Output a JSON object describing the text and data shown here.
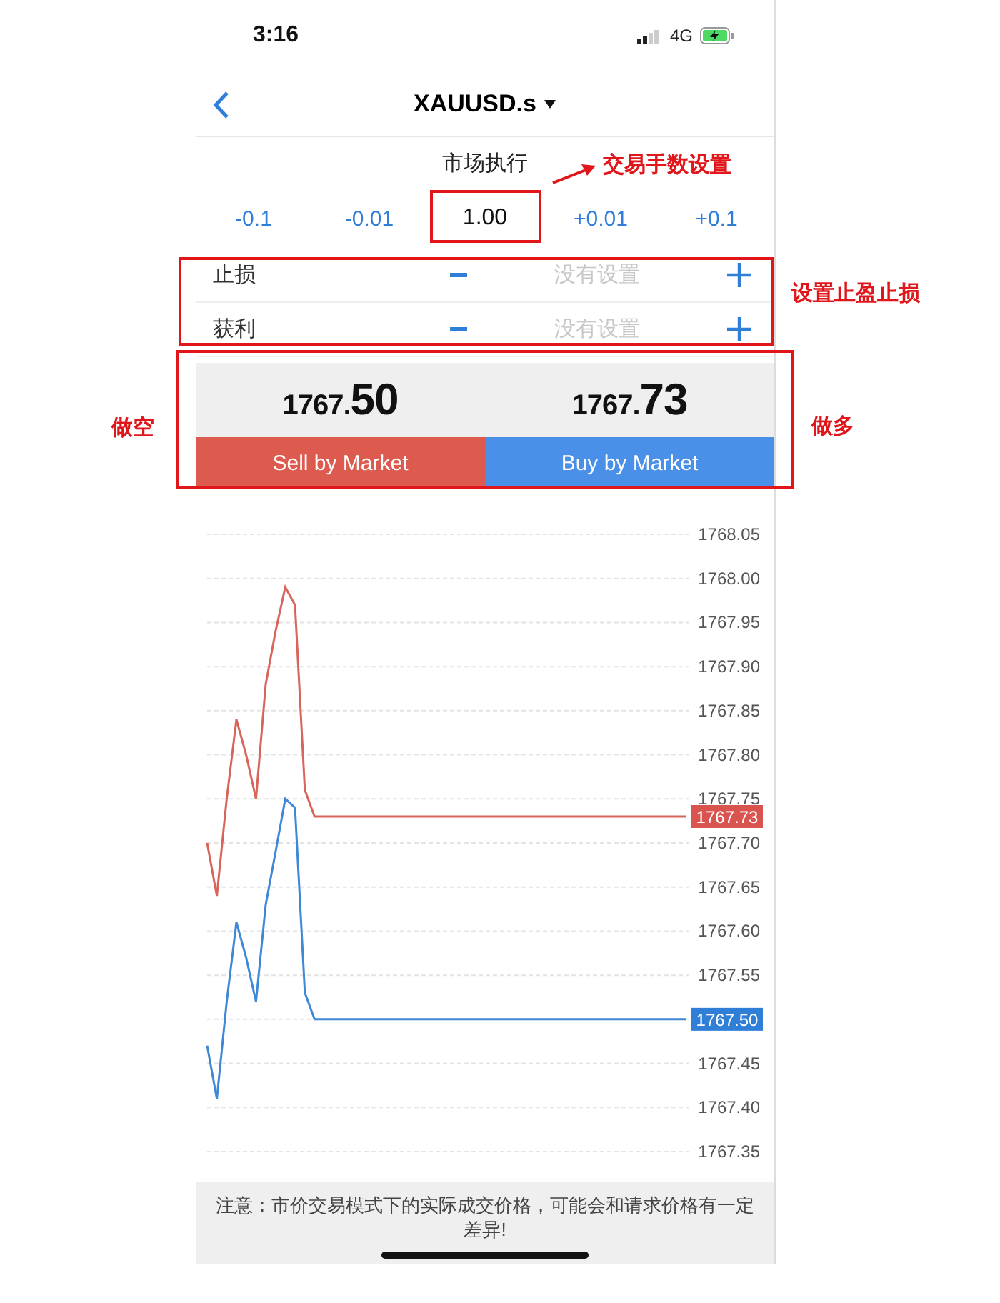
{
  "status_bar": {
    "time": "3:16",
    "network": "4G"
  },
  "nav": {
    "title": "XAUUSD.s"
  },
  "order": {
    "mode": "市场执行",
    "lot_steps_minus": [
      "-0.1",
      "-0.01"
    ],
    "volume": "1.00",
    "lot_steps_plus": [
      "+0.01",
      "+0.1"
    ],
    "levels": [
      {
        "label": "止损",
        "placeholder": "没有设置"
      },
      {
        "label": "获利",
        "placeholder": "没有设置"
      }
    ]
  },
  "prices": {
    "bid": {
      "big_figure": "1767.",
      "pips": "50"
    },
    "ask": {
      "big_figure": "1767.",
      "pips": "73"
    },
    "sell_button": "Sell by Market",
    "buy_button": "Buy by Market"
  },
  "chart": {
    "chart_data": {
      "type": "line",
      "grid": true,
      "ylim": [
        1767.35,
        1768.05
      ],
      "series": [
        {
          "color": "#d9645a",
          "values": [
            1767.7,
            1767.64,
            1767.75,
            1767.84,
            1767.8,
            1767.75,
            1767.88,
            1767.94,
            1767.99,
            1767.97,
            1767.76,
            1767.73,
            1767.73,
            1767.73,
            1767.73,
            1767.73,
            1767.73,
            1767.73,
            1767.73,
            1767.73,
            1767.73,
            1767.73,
            1767.73,
            1767.73,
            1767.73,
            1767.73,
            1767.73,
            1767.73,
            1767.73,
            1767.73,
            1767.73,
            1767.73,
            1767.73,
            1767.73,
            1767.73,
            1767.73,
            1767.73,
            1767.73,
            1767.73,
            1767.73,
            1767.73,
            1767.73,
            1767.73,
            1767.73,
            1767.73,
            1767.73,
            1767.73,
            1767.73,
            1767.73,
            1767.73
          ]
        },
        {
          "color": "#3f88d6",
          "values": [
            1767.47,
            1767.41,
            1767.52,
            1767.61,
            1767.57,
            1767.52,
            1767.63,
            1767.69,
            1767.75,
            1767.74,
            1767.53,
            1767.5,
            1767.5,
            1767.5,
            1767.5,
            1767.5,
            1767.5,
            1767.5,
            1767.5,
            1767.5,
            1767.5,
            1767.5,
            1767.5,
            1767.5,
            1767.5,
            1767.5,
            1767.5,
            1767.5,
            1767.5,
            1767.5,
            1767.5,
            1767.5,
            1767.5,
            1767.5,
            1767.5,
            1767.5,
            1767.5,
            1767.5,
            1767.5,
            1767.5,
            1767.5,
            1767.5,
            1767.5,
            1767.5,
            1767.5,
            1767.5,
            1767.5,
            1767.5,
            1767.5,
            1767.5
          ]
        }
      ],
      "yticks": [
        {
          "value": 1768.05,
          "label": "1768.05"
        },
        {
          "value": 1768.0,
          "label": "1768.00"
        },
        {
          "value": 1767.95,
          "label": "1767.95"
        },
        {
          "value": 1767.9,
          "label": "1767.90"
        },
        {
          "value": 1767.85,
          "label": "1767.85"
        },
        {
          "value": 1767.8,
          "label": "1767.80"
        },
        {
          "value": 1767.75,
          "label": "1767.75"
        },
        {
          "value": 1767.7,
          "label": "1767.70"
        },
        {
          "value": 1767.65,
          "label": "1767.65"
        },
        {
          "value": 1767.6,
          "label": "1767.60"
        },
        {
          "value": 1767.55,
          "label": "1767.55"
        },
        {
          "value": 1767.5,
          "label": "1767.50"
        },
        {
          "value": 1767.45,
          "label": "1767.45"
        },
        {
          "value": 1767.4,
          "label": "1767.40"
        },
        {
          "value": 1767.35,
          "label": "1767.35"
        }
      ]
    },
    "price_tags": [
      {
        "text": "1767.73",
        "color": "#d9534f"
      },
      {
        "text": "1767.50",
        "color": "#2f7fd8"
      }
    ]
  },
  "notice": "注意：市价交易模式下的实际成交价格，可能会和请求价格有一定差异!",
  "annotations": [
    "交易手数设置",
    "设置止盈止损",
    "做空",
    "做多"
  ]
}
